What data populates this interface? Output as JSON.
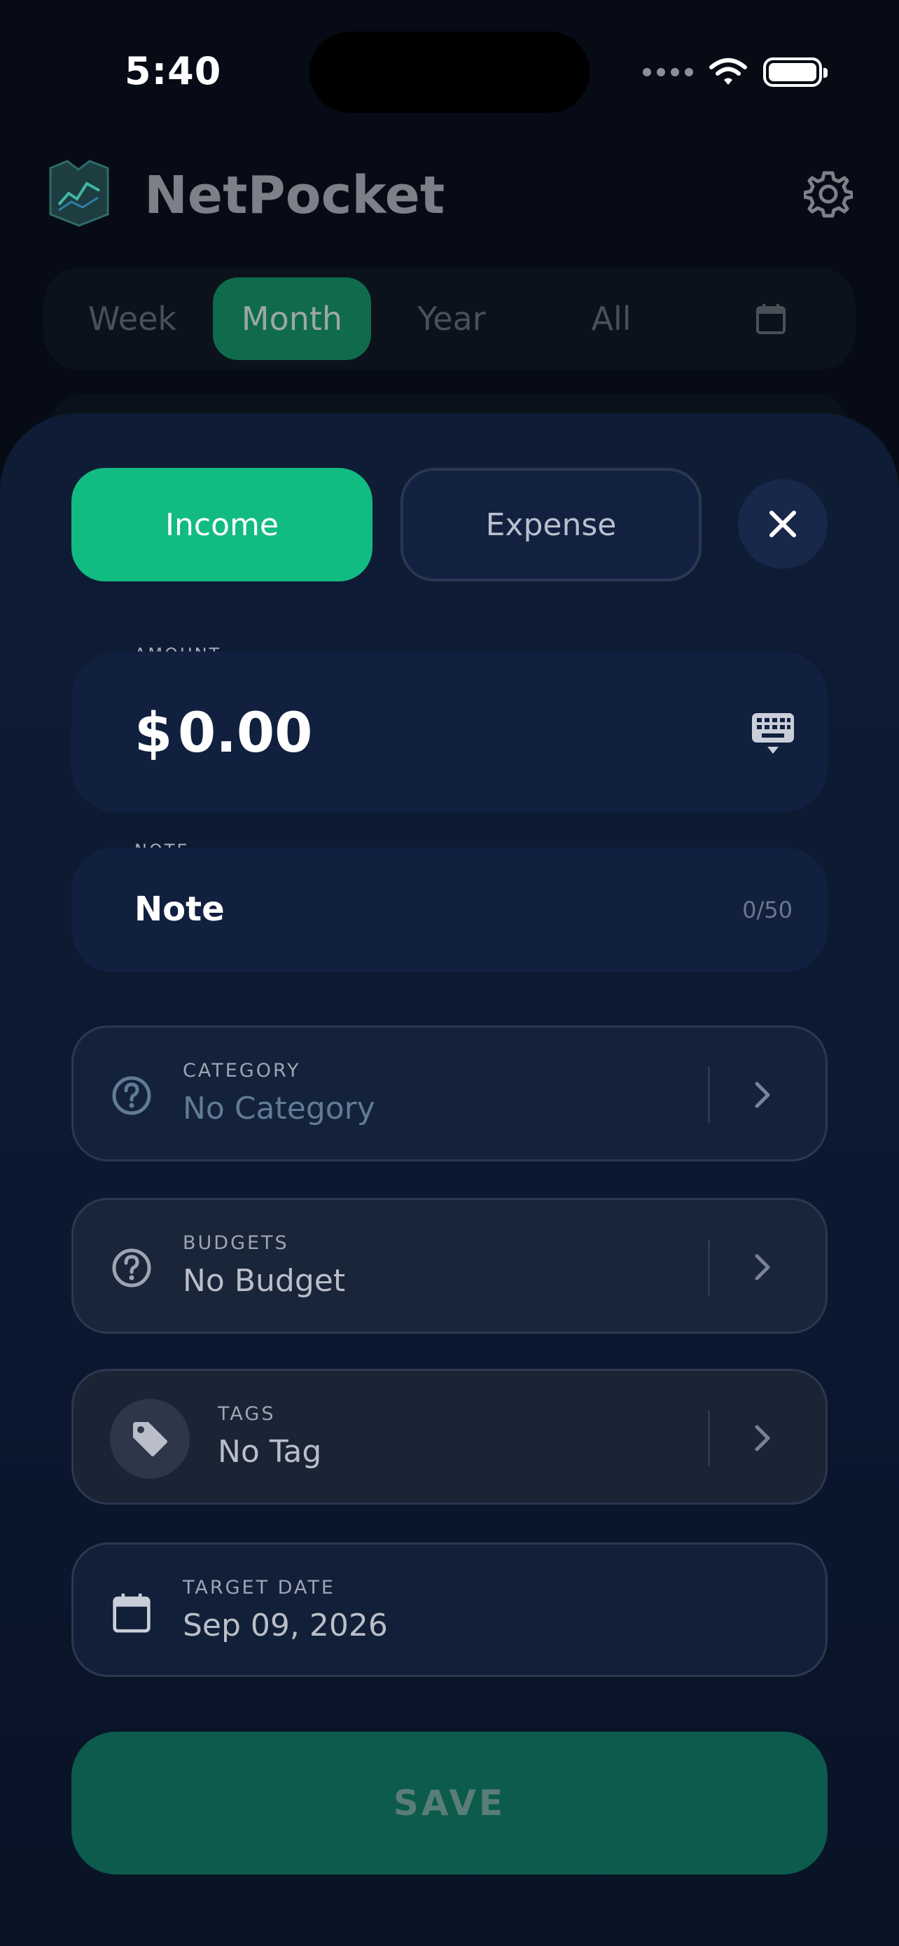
{
  "status_bar": {
    "time": "5:40"
  },
  "header": {
    "app_name": "NetPocket",
    "logo_icon": "wallet-chart-icon",
    "settings_icon": "gear-icon"
  },
  "period_tabs": [
    {
      "label": "Week",
      "active": false
    },
    {
      "label": "Month",
      "active": true
    },
    {
      "label": "Year",
      "active": false
    },
    {
      "label": "All",
      "active": false
    }
  ],
  "period_calendar_icon": "calendar-icon",
  "sheet": {
    "type_toggle": {
      "income_label": "Income",
      "expense_label": "Expense",
      "selected": "Income"
    },
    "close_icon": "close-icon",
    "amount": {
      "label": "AMOUNT",
      "currency": "$",
      "value": "0.00"
    },
    "note": {
      "label": "NOTE",
      "placeholder": "Note",
      "counter": "0/50"
    },
    "category": {
      "label": "CATEGORY",
      "value": "No Category"
    },
    "budgets": {
      "label": "BUDGETS",
      "value": "No Budget"
    },
    "tags": {
      "label": "TAGS",
      "value": "No Tag"
    },
    "target_date": {
      "label": "TARGET DATE",
      "value": "Sep 09, 2026"
    },
    "save_label": "SAVE"
  },
  "colors": {
    "accent": "#12bb82",
    "background": "#060b15",
    "sheet": "#0e1c35",
    "save_button": "#0c5b4c"
  }
}
